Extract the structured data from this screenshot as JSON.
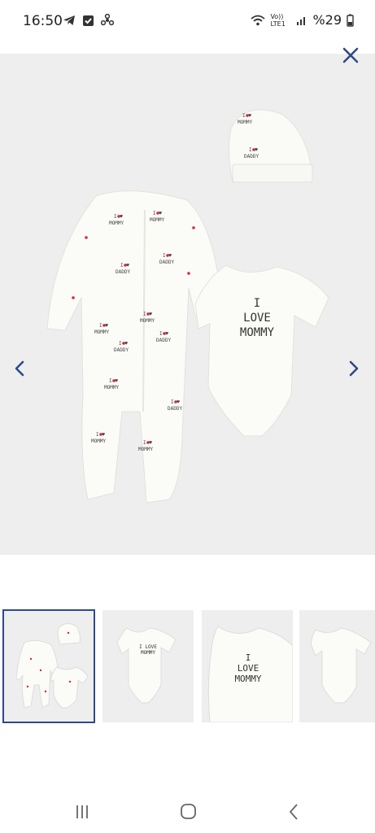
{
  "status_bar": {
    "time": "16:50",
    "network": "Vo)) LTE1",
    "battery": "%29"
  },
  "viewer": {
    "main_print": {
      "line1": "I",
      "word": "LOVE",
      "line3": "MOMMY"
    }
  },
  "thumbnails": [
    {
      "label": ""
    },
    {
      "label": "I LOVE MOMMY"
    },
    {
      "line1": "I",
      "line2": "LOVE",
      "line3": "MOMMY"
    },
    {
      "label": ""
    }
  ],
  "icons": {
    "close": "close-icon",
    "prev": "chevron-left-icon",
    "next": "chevron-right-icon"
  }
}
